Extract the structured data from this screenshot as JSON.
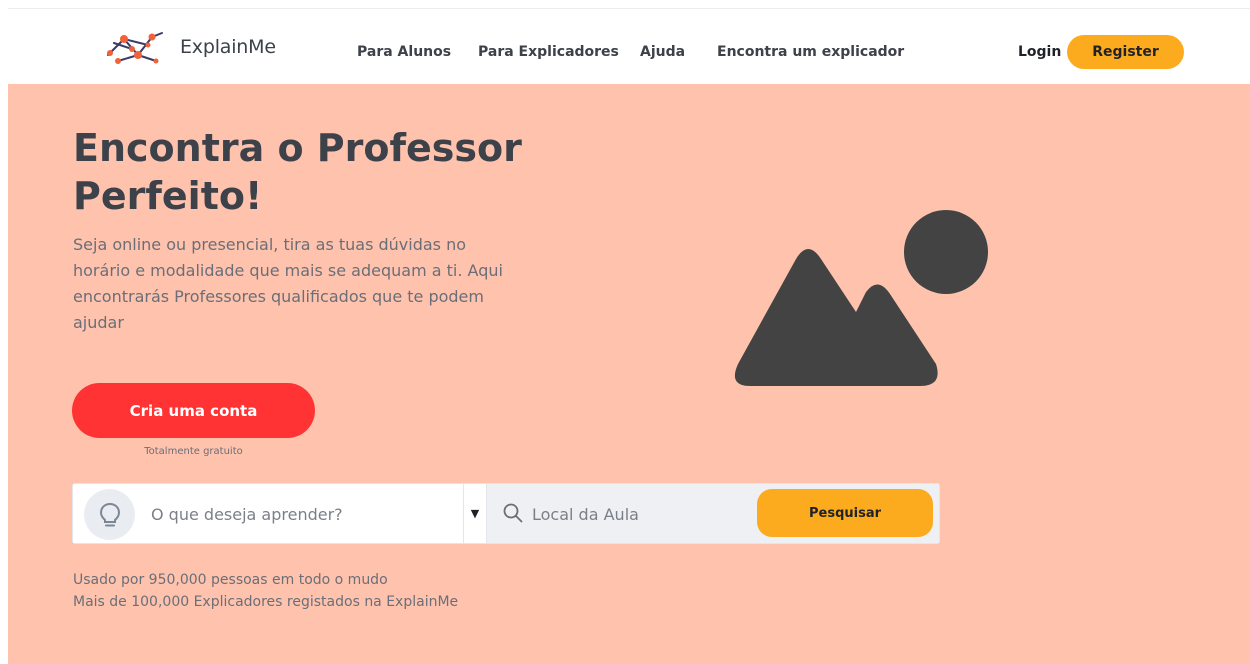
{
  "brand": {
    "name": "ExplainMe",
    "logo_color": "#f0623a",
    "logo_line_color": "#3a3a66"
  },
  "nav": {
    "items": [
      {
        "label": "Para Alunos"
      },
      {
        "label": "Para Explicadores"
      },
      {
        "label": "Ajuda"
      },
      {
        "label": "Encontra um explicador"
      }
    ],
    "login_label": "Login",
    "register_label": "Register"
  },
  "hero": {
    "headline_line1": "Encontra o Professor",
    "headline_line2": "Perfeito!",
    "description": "Seja online ou presencial, tira as tuas dúvidas no horário e modalidade que mais se adequam a ti. Aqui encontrarás Professores qualificados que te podem ajudar",
    "cta_label": "Cria uma conta",
    "cta_note": "Totalmente gratuito",
    "image_icon": "image-placeholder-icon"
  },
  "search": {
    "subject_placeholder": "O que deseja aprender?",
    "subject_value": "",
    "dropdown_symbol": "▼",
    "location_placeholder": "Local da Aula",
    "location_value": "",
    "button_label": "Pesquisar",
    "bulb_icon": "lightbulb-icon",
    "search_icon": "search-icon"
  },
  "stats": {
    "line1": "Usado por 950,000 pessoas em todo o mudo",
    "line2": "Mais de 100,000 Explicadores registados na ExplainMe"
  },
  "colors": {
    "hero_bg": "#ffc3ad",
    "accent_yellow": "#fcab1e",
    "cta_red": "#ff3333",
    "text_dark": "#3d4149",
    "text_muted": "#6a6e78"
  }
}
